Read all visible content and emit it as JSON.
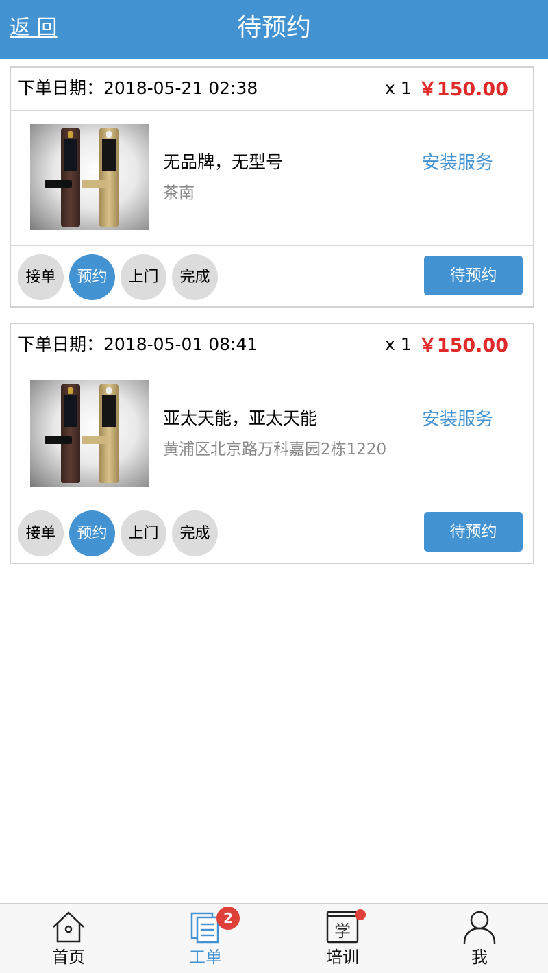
{
  "header": {
    "back_label": "返 回",
    "title": "待预约"
  },
  "orders": [
    {
      "date_label": "下单日期：2018-05-21 02:38",
      "quantity": "x 1",
      "price": "￥150.00",
      "product_name": "无品牌，无型号",
      "address": "茶南",
      "service_type": "安装服务",
      "steps": [
        "接单",
        "预约",
        "上门",
        "完成"
      ],
      "active_step": 1,
      "status_button": "待预约"
    },
    {
      "date_label": "下单日期：2018-05-01 08:41",
      "quantity": "x 1",
      "price": "￥150.00",
      "product_name": "亚太天能，亚太天能",
      "address": "黄浦区北京路万科嘉园2栋1220",
      "service_type": "安装服务",
      "steps": [
        "接单",
        "预约",
        "上门",
        "完成"
      ],
      "active_step": 1,
      "status_button": "待预约"
    }
  ],
  "tabbar": {
    "items": [
      {
        "label": "首页",
        "icon": "home-icon"
      },
      {
        "label": "工单",
        "icon": "work-order-icon",
        "badge": "2"
      },
      {
        "label": "培训",
        "icon": "training-book-icon",
        "icon_text": "学"
      },
      {
        "label": "我",
        "icon": "user-icon"
      }
    ],
    "active_index": 1
  },
  "colors": {
    "primary": "#4393d3",
    "price": "#e02a2a",
    "badge": "#e0403a"
  }
}
